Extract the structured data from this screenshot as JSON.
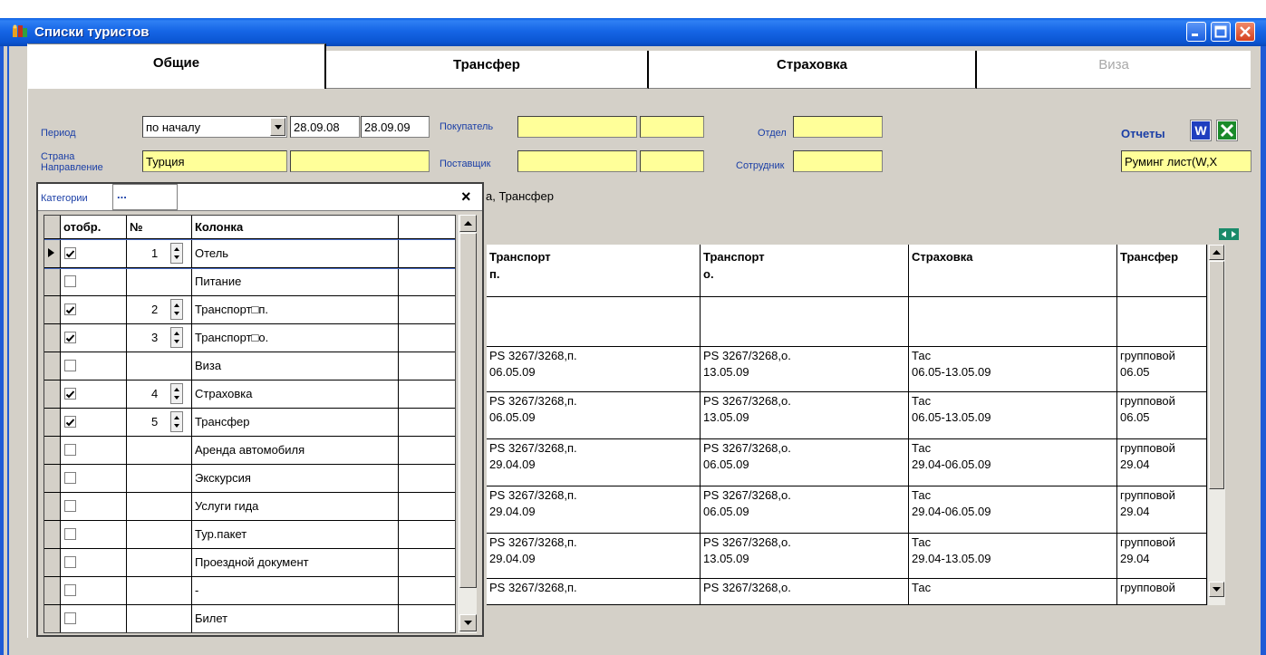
{
  "window": {
    "title": "Списки туристов"
  },
  "tabs": [
    {
      "label": "Общие",
      "state": "active"
    },
    {
      "label": "Трансфер",
      "state": "normal"
    },
    {
      "label": "Страховка",
      "state": "normal"
    },
    {
      "label": "Виза",
      "state": "disabled"
    }
  ],
  "filters": {
    "period_label": "Период",
    "period_mode": "по началу",
    "date_from": "28.09.08",
    "date_to": "28.09.09",
    "country_label": "Страна",
    "direction_label": "Направление",
    "country_value": "Турция",
    "buyer_label": "Покупатель",
    "supplier_label": "Поставщик",
    "department_label": "Отдел",
    "employee_label": "Сотрудник",
    "reports_label": "Отчеты",
    "report_select": "Руминг лист(W,X"
  },
  "categories": {
    "label": "Категории",
    "button": "...",
    "close": "×",
    "selected_text": "а, Трансфер",
    "headers": {
      "show": "отобр.",
      "num": "№",
      "column": "Колонка"
    },
    "rows": [
      {
        "checked": true,
        "num": "1",
        "name": "Отель"
      },
      {
        "checked": false,
        "num": "",
        "name": "Питание"
      },
      {
        "checked": true,
        "num": "2",
        "name": "Транспорт□п."
      },
      {
        "checked": true,
        "num": "3",
        "name": "Транспорт□о."
      },
      {
        "checked": false,
        "num": "",
        "name": "Виза"
      },
      {
        "checked": true,
        "num": "4",
        "name": "Страховка"
      },
      {
        "checked": true,
        "num": "5",
        "name": "Трансфер"
      },
      {
        "checked": false,
        "num": "",
        "name": "Аренда автомобиля"
      },
      {
        "checked": false,
        "num": "",
        "name": "Экскурсия"
      },
      {
        "checked": false,
        "num": "",
        "name": "Услуги гида"
      },
      {
        "checked": false,
        "num": "",
        "name": "Тур.пакет"
      },
      {
        "checked": false,
        "num": "",
        "name": "Проездной документ"
      },
      {
        "checked": false,
        "num": "",
        "name": "-"
      },
      {
        "checked": false,
        "num": "",
        "name": "Билет"
      }
    ]
  },
  "grid": {
    "headers": [
      {
        "l1": "Транспорт",
        "l2": "п."
      },
      {
        "l1": "Транспорт",
        "l2": "о."
      },
      {
        "l1": "Страховка",
        "l2": ""
      },
      {
        "l1": "Трансфер",
        "l2": ""
      }
    ],
    "rows": [
      [
        [
          "",
          ""
        ],
        [
          "",
          ""
        ],
        [
          "",
          ""
        ],
        [
          "",
          ""
        ]
      ],
      [
        [
          "PS 3267/3268,п.",
          "06.05.09"
        ],
        [
          "PS 3267/3268,о.",
          "13.05.09"
        ],
        [
          "Тас",
          "06.05-13.05.09"
        ],
        [
          "групповой",
          "06.05"
        ]
      ],
      [
        [
          "PS 3267/3268,п.",
          "06.05.09"
        ],
        [
          "PS 3267/3268,о.",
          "13.05.09"
        ],
        [
          "Тас",
          "06.05-13.05.09"
        ],
        [
          "групповой",
          "06.05"
        ]
      ],
      [
        [
          "PS 3267/3268,п.",
          "29.04.09"
        ],
        [
          "PS 3267/3268,о.",
          "06.05.09"
        ],
        [
          "Тас",
          "29.04-06.05.09"
        ],
        [
          "групповой",
          "29.04"
        ]
      ],
      [
        [
          "PS 3267/3268,п.",
          "29.04.09"
        ],
        [
          "PS 3267/3268,о.",
          "06.05.09"
        ],
        [
          "Тас",
          "29.04-06.05.09"
        ],
        [
          "групповой",
          "29.04"
        ]
      ],
      [
        [
          "PS 3267/3268,п.",
          "29.04.09"
        ],
        [
          "PS 3267/3268,о.",
          "13.05.09"
        ],
        [
          "Тас",
          "29.04-13.05.09"
        ],
        [
          "групповой",
          "29.04"
        ]
      ],
      [
        [
          "PS 3267/3268,п.",
          ""
        ],
        [
          "PS 3267/3268,о.",
          ""
        ],
        [
          "Тас",
          ""
        ],
        [
          "групповой",
          ""
        ]
      ]
    ]
  },
  "colors": {
    "titlebar": "#0b55d2",
    "field_yellow": "#ffff99",
    "label_blue": "#1a3ea6",
    "word_icon": "#1f3fbf",
    "excel_icon": "#1a8a2a"
  },
  "icons": {
    "app": "people-icon",
    "word": "word-icon",
    "excel": "excel-icon",
    "expand": "expand-columns-icon"
  }
}
